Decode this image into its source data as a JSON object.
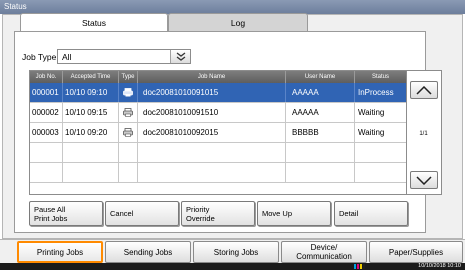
{
  "window": {
    "title": "Status"
  },
  "tabs": [
    {
      "label": "Status",
      "active": true
    },
    {
      "label": "Log",
      "active": false
    }
  ],
  "job_type": {
    "label": "Job Type",
    "value": "All"
  },
  "table": {
    "columns": [
      "Job No.",
      "Accepted Time",
      "Type",
      "Job Name",
      "User Name",
      "Status"
    ],
    "rows": [
      {
        "job_no": "000001",
        "time": "10/10 09:10",
        "type_icon": "print-job-icon",
        "name": "doc20081010091015",
        "user": "AAAAA",
        "status": "InProcess",
        "selected": true
      },
      {
        "job_no": "000002",
        "time": "10/10 09:15",
        "type_icon": "print-job-icon",
        "name": "doc20081010091510",
        "user": "AAAAA",
        "status": "Waiting",
        "selected": false
      },
      {
        "job_no": "000003",
        "time": "10/10 09:20",
        "type_icon": "print-job-icon",
        "name": "doc20081010092015",
        "user": "BBBBB",
        "status": "Waiting",
        "selected": false
      }
    ],
    "page_indicator": "1/1"
  },
  "actions": {
    "pause_all_line1": "Pause All",
    "pause_all_line2": "Print Jobs",
    "cancel": "Cancel",
    "priority_line1": "Priority",
    "priority_line2": "Override",
    "move_up": "Move Up",
    "detail": "Detail"
  },
  "bottom_nav": {
    "printing_jobs": "Printing Jobs",
    "sending_jobs": "Sending Jobs",
    "storing_jobs": "Storing Jobs",
    "device_line1": "Device/",
    "device_line2": "Communication",
    "paper_supplies": "Paper/Supplies"
  },
  "statusbar": {
    "clock": "10/10/2018 10:10"
  },
  "colors": {
    "selected_row": "#3064b4",
    "active_nav_border": "#ff8a00",
    "toner": [
      "#00a0e0",
      "#e0007a",
      "#f0d000",
      "#202020"
    ]
  }
}
